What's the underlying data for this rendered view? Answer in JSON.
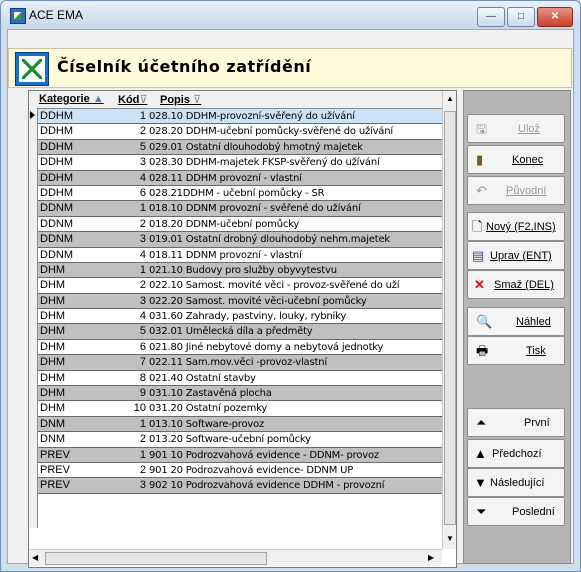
{
  "window": {
    "title": "ACE EMA",
    "minimize": "—",
    "maximize": "□",
    "close": "✕"
  },
  "header": {
    "title": "Číselník účetního zatřídění"
  },
  "table": {
    "columns": [
      "Kategorie",
      "Kód",
      "Popis"
    ],
    "sort_marks": [
      "▲",
      "⊽",
      "⊽"
    ],
    "rows": [
      [
        "DDHM",
        "1",
        "028.10 DDHM-provozní-svěřený do užívání"
      ],
      [
        "DDHM",
        "2",
        "028.20 DDHM-učební pomůcky-svěřené do užívání"
      ],
      [
        "DDHM",
        "5",
        "029.01 Ostatní dlouhodobý hmotný majetek"
      ],
      [
        "DDHM",
        "3",
        "028.30 DDHM-majetek FKSP-svěřený do užívání"
      ],
      [
        "DDHM",
        "4",
        "028.11 DDHM provozní - vlastní"
      ],
      [
        "DDHM",
        "6",
        "028.21DDHM - učební pomůcky - SR"
      ],
      [
        "DDNM",
        "1",
        "018.10 DDNM provozní - svěřené do užívání"
      ],
      [
        "DDNM",
        "2",
        "018.20 DDNM-učební pomůcky"
      ],
      [
        "DDNM",
        "3",
        "019.01 Ostatní drobný dlouhodobý nehm.majetek"
      ],
      [
        "DDNM",
        "4",
        "018.11 DDNM provozní - vlastní"
      ],
      [
        "DHM",
        "1",
        "021.10 Budovy pro služby obyvytestvu"
      ],
      [
        "DHM",
        "2",
        "022.10 Samost. movité věci - provoz-svěřené do uží"
      ],
      [
        "DHM",
        "3",
        "022.20 Samost. movité věci-učební pomůcky"
      ],
      [
        "DHM",
        "4",
        "031.60 Zahrady, pastviny, louky, rybníky"
      ],
      [
        "DHM",
        "5",
        "032.01 Umělecká díla a předměty"
      ],
      [
        "DHM",
        "6",
        "021.80 Jiné nebytové domy a nebytová jednotky"
      ],
      [
        "DHM",
        "7",
        "022.11 Sam.mov.věci -provoz-vlastní"
      ],
      [
        "DHM",
        "8",
        "021.40 Ostatní stavby"
      ],
      [
        "DHM",
        "9",
        "031.10 Zastavěná plocha"
      ],
      [
        "DHM",
        "10",
        "031.20 Ostatní pozemky"
      ],
      [
        "DNM",
        "1",
        "013.10 Software-provoz"
      ],
      [
        "DNM",
        "2",
        "013.20 Software-učební pomůcky"
      ],
      [
        "PREV",
        "1",
        "901 10  Podrozvahová evidence - DDNM- provoz"
      ],
      [
        "PREV",
        "2",
        "901 20 Podrozvahová evidence- DDNM UP"
      ],
      [
        "PREV",
        "3",
        "902 10 Podrozvahová evidence DDHM - provozní"
      ]
    ]
  },
  "buttons": {
    "save": "Ulož",
    "end": "Konec",
    "original": "Původní",
    "new": "Nový (F2,INS)",
    "edit": "Uprav (ENT)",
    "delete": "Smaž (DEL)",
    "preview": "Náhled",
    "print": "Tisk",
    "first": "První",
    "previous": "Předchozí",
    "next": "Následující",
    "last": "Poslední"
  },
  "icons": {
    "save": "floppy-icon",
    "end": "exit-door-icon",
    "original": "undo-icon",
    "new": "new-document-icon",
    "edit": "edit-form-icon",
    "delete": "red-x-icon",
    "preview": "magnifier-page-icon",
    "print": "printer-icon",
    "first": "first-record-icon",
    "previous": "previous-record-icon",
    "next": "next-record-icon",
    "last": "last-record-icon"
  },
  "colors": {
    "header_bg": "#fffadb",
    "alt_row": "#c0c0c0",
    "selected_row": "#cce3f7",
    "panel_bg": "#b5b5b5"
  }
}
